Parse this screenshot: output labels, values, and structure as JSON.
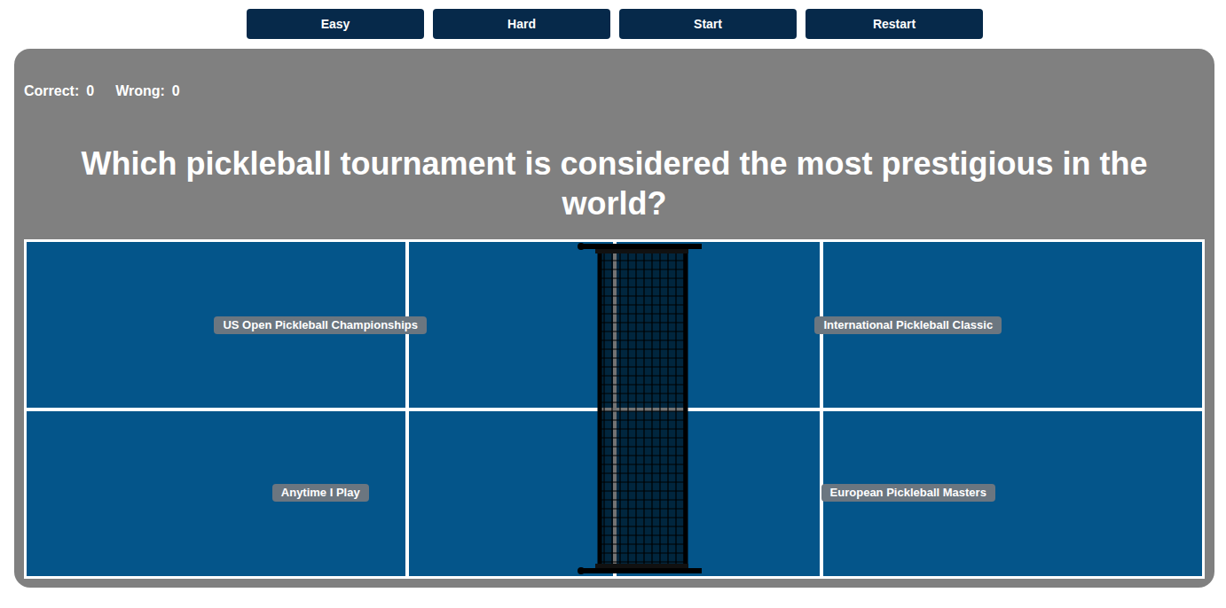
{
  "controls": [
    {
      "label": "Easy"
    },
    {
      "label": "Hard"
    },
    {
      "label": "Start"
    },
    {
      "label": "Restart"
    }
  ],
  "score": [
    {
      "label": "Correct:",
      "value": "0"
    },
    {
      "label": "Wrong:",
      "value": "0"
    }
  ],
  "question": "Which pickleball tournament is considered the most prestigious in the world?",
  "answers": [
    {
      "label": "US Open Pickleball Championships"
    },
    {
      "label": "International Pickleball Classic"
    },
    {
      "label": "Anytime I Play"
    },
    {
      "label": "European Pickleball Masters"
    }
  ]
}
